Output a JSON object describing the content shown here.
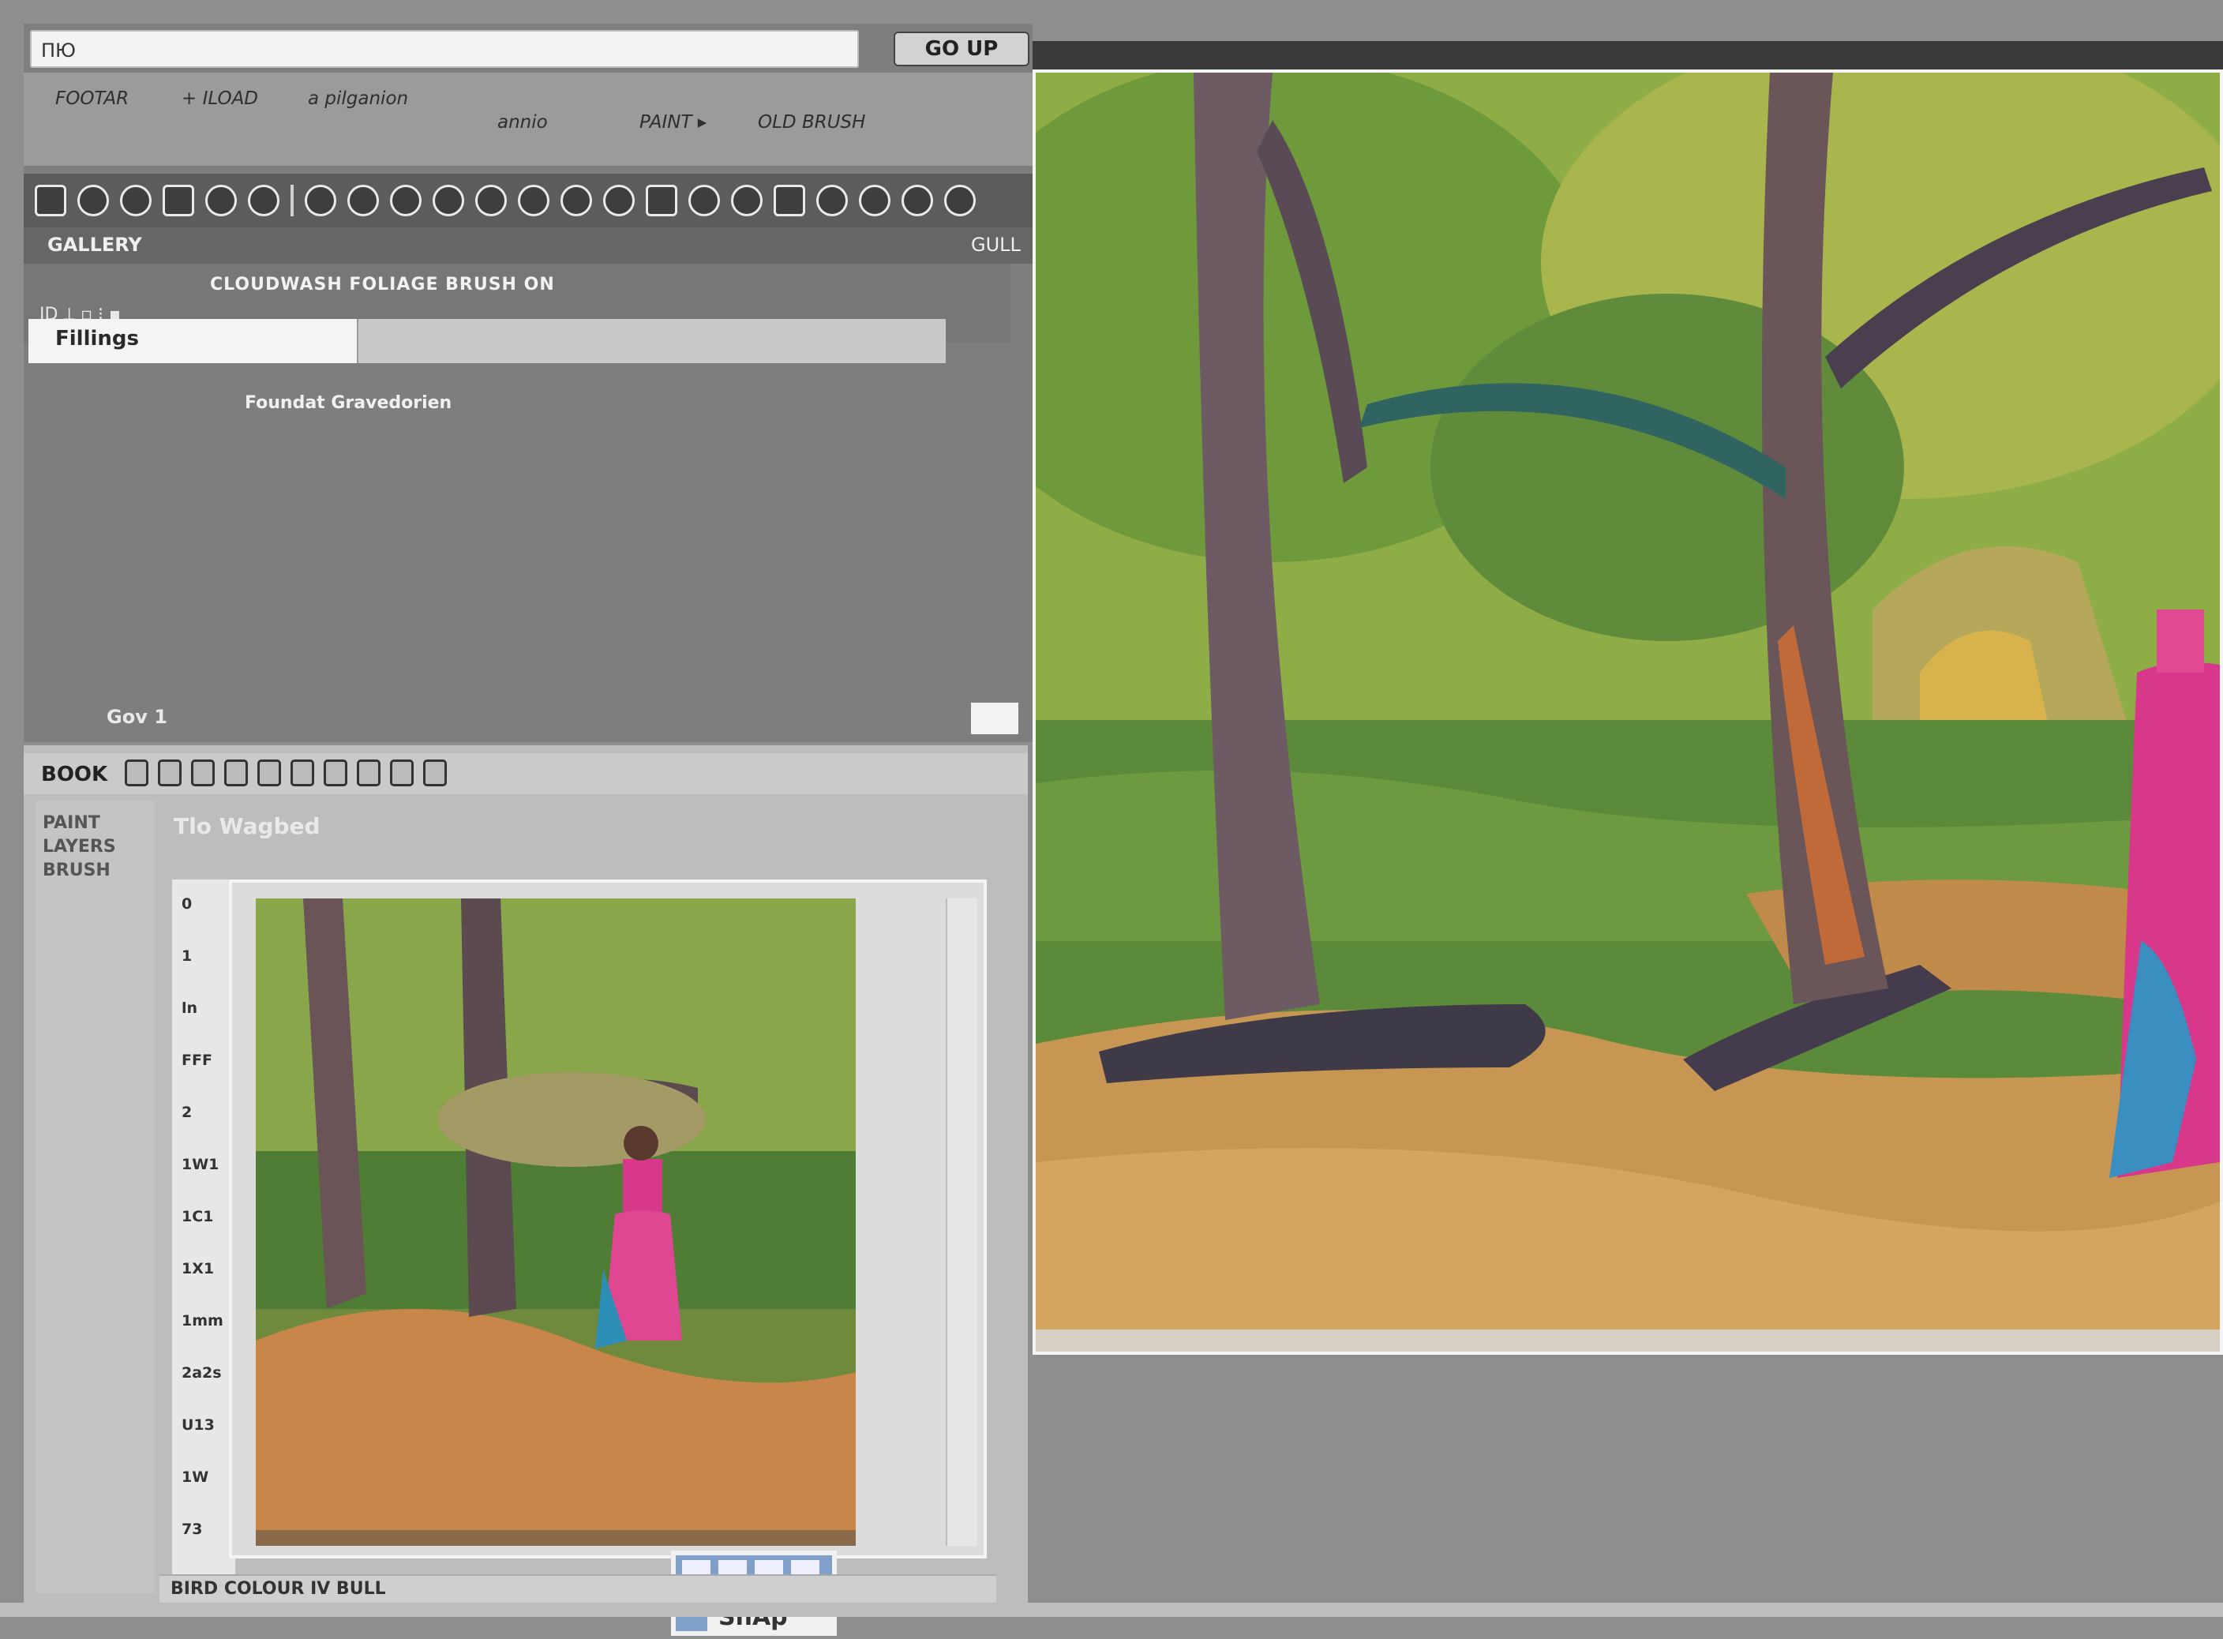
{
  "top_window": {
    "address": "ПЮ",
    "go_button": "GO UP",
    "menu": [
      "FOOTAR",
      "+ ILOAD",
      "a pilganion",
      "annio",
      "PAINT ▸",
      "OLD BRUSH"
    ],
    "sub_label": "GALLERY",
    "sub_right": "GULL",
    "props_title": "CLOUDWASH FOLIAGE BRUSH ON",
    "props_row": "ID   ⟂   ▫   ⁝   ▪",
    "slider_label": "Fillings",
    "slider_value": 0.36,
    "caption": "Foundat Gravedorien",
    "status": "Gov 1"
  },
  "bottom_window": {
    "toolbar_label": "BOOK",
    "doc_title": "Tlo Wagbed",
    "side_text": [
      "PAINT",
      "LAYERS",
      "BRUSH"
    ],
    "ruler": [
      "0",
      "1",
      "ln",
      "FFF",
      "2",
      "1W1",
      "1C1",
      "1X1",
      "1mm",
      "2a2s",
      "U13",
      "1W",
      "73"
    ],
    "status_text": "BIRD COLOUR IV BULL",
    "thumb_label": "ShAp"
  },
  "canvas": {
    "description_colors": {
      "sky": "#9bb24a",
      "grass": "#5e8a3a",
      "path": "#c89a55",
      "trunk": "#6b5a5e",
      "figure": "#d83a8a",
      "skirt": "#3a8ec0"
    }
  }
}
